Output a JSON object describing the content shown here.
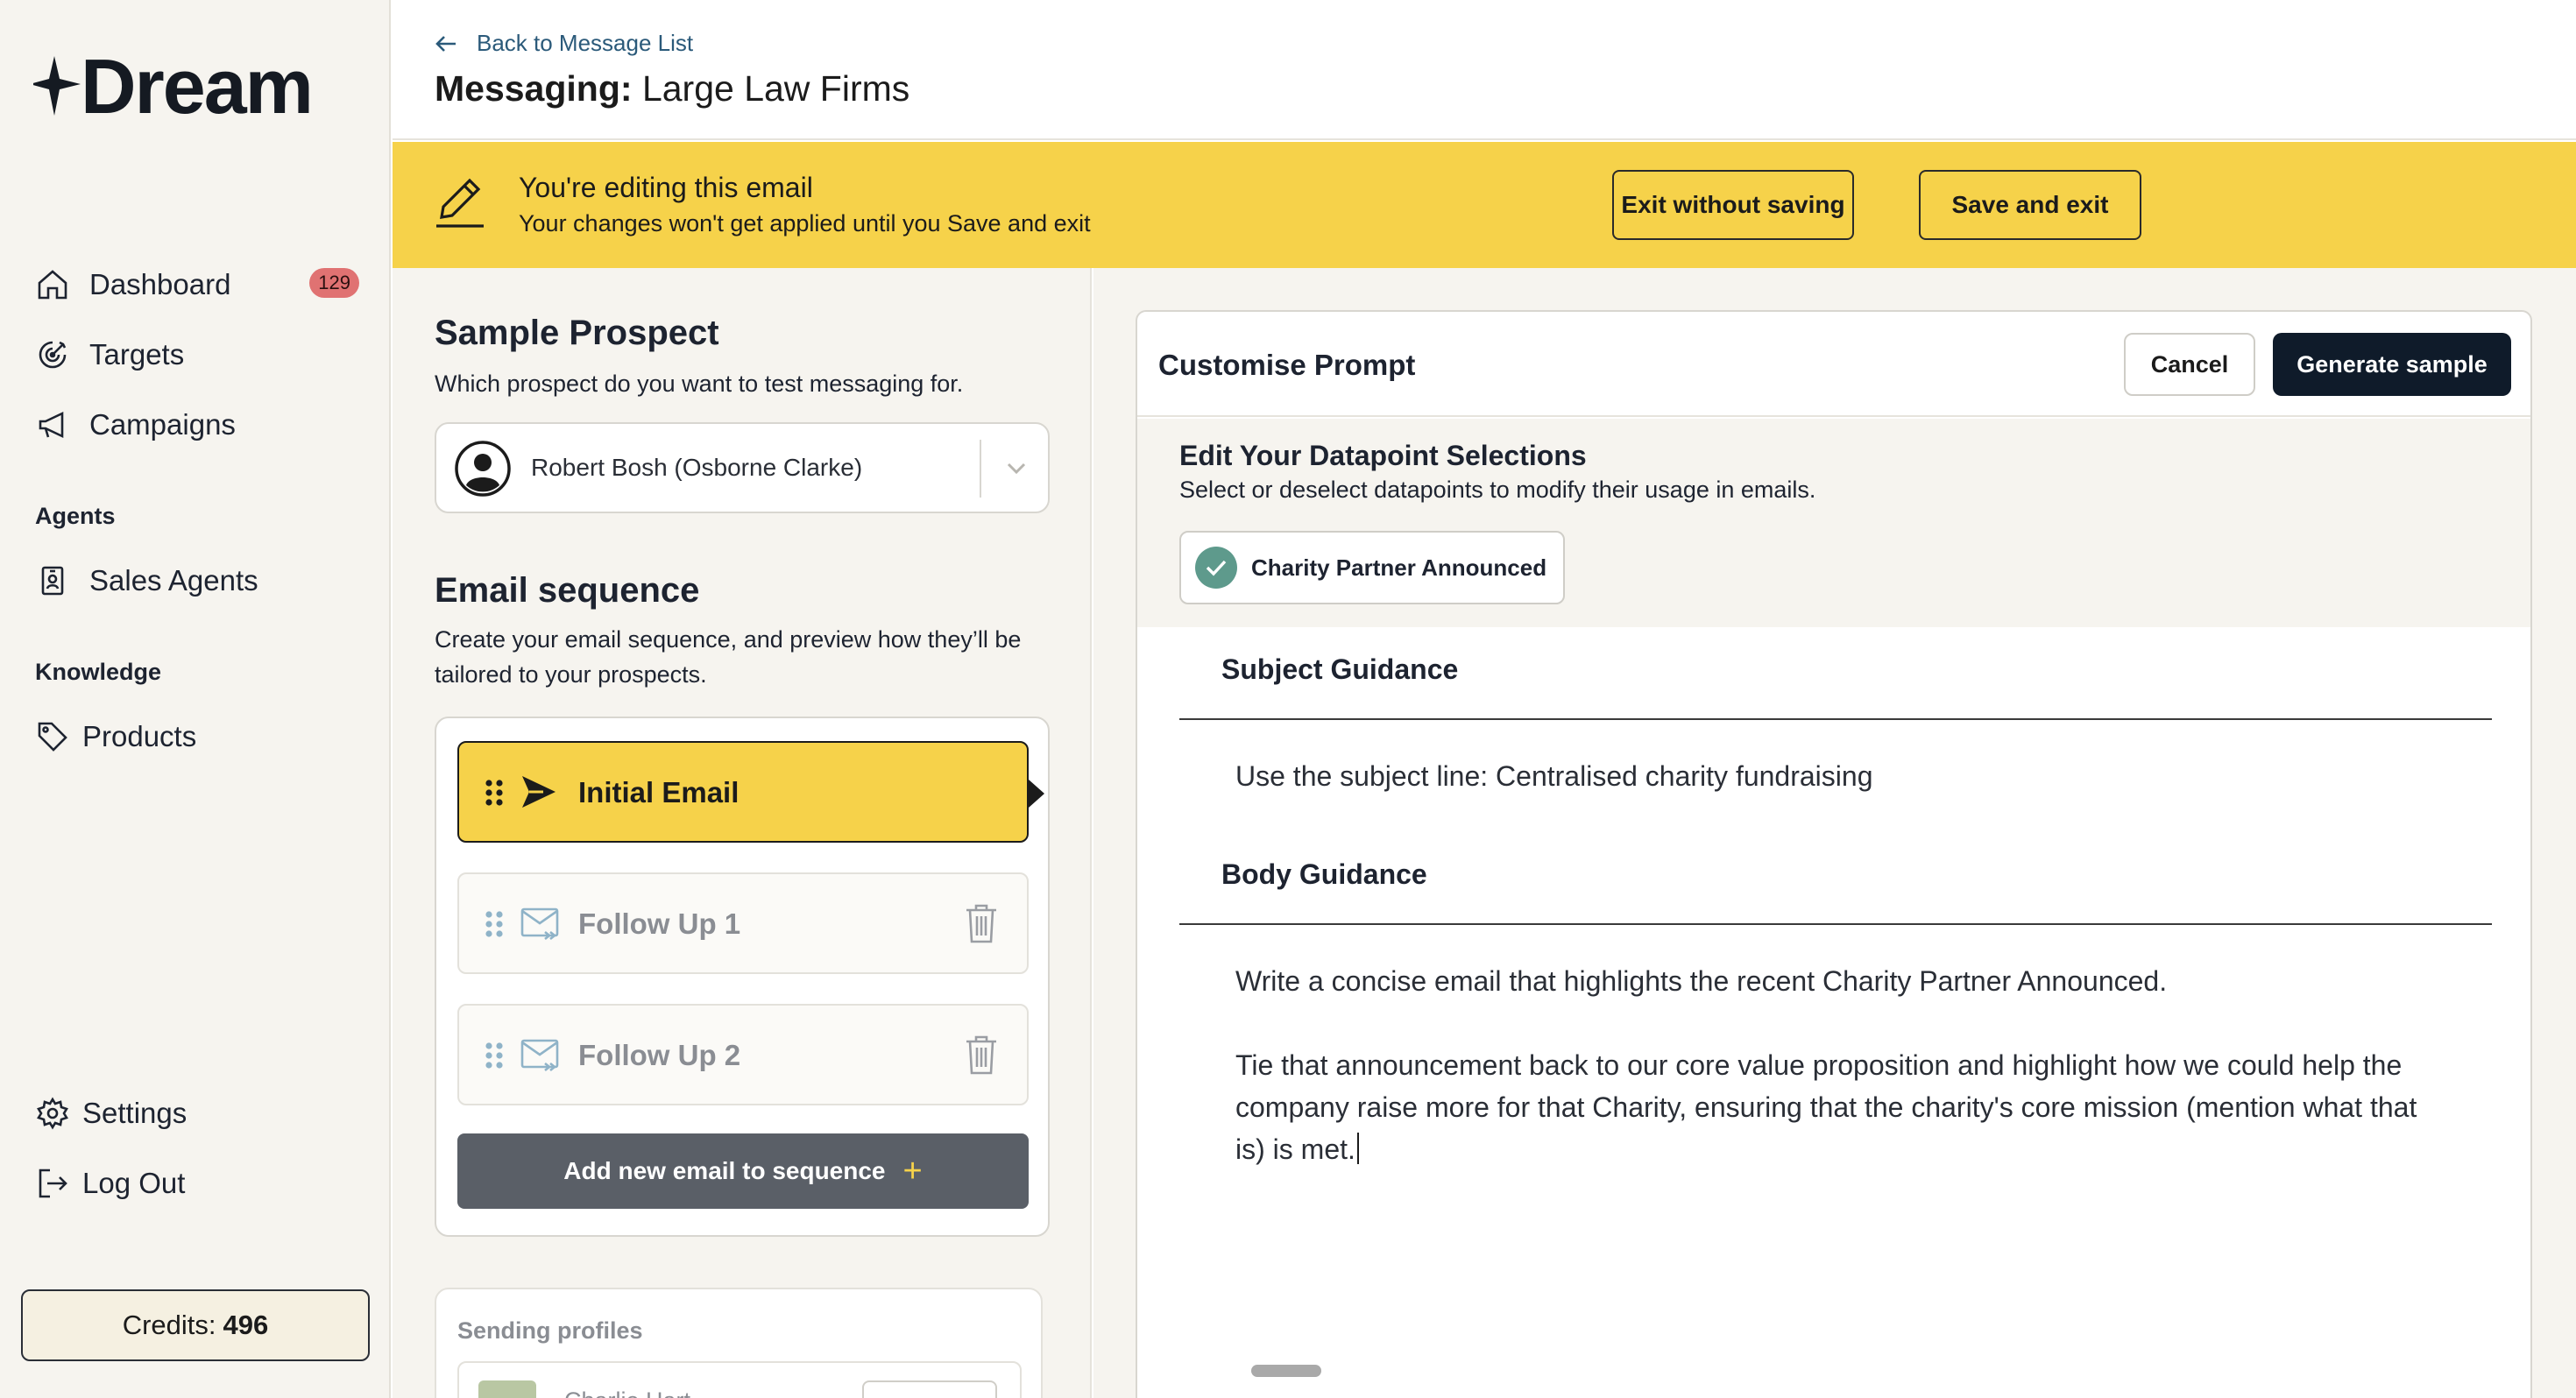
{
  "app": {
    "logo_text": "Dream"
  },
  "sidebar": {
    "nav": [
      {
        "label": "Dashboard",
        "icon": "home-icon",
        "badge": "129"
      },
      {
        "label": "Targets",
        "icon": "target-icon"
      },
      {
        "label": "Campaigns",
        "icon": "megaphone-icon"
      }
    ],
    "sections": {
      "agents": {
        "title": "Agents",
        "items": [
          {
            "label": "Sales Agents",
            "icon": "id-badge-icon"
          }
        ]
      },
      "knowledge": {
        "title": "Knowledge",
        "items": [
          {
            "label": "Products",
            "icon": "tag-icon"
          }
        ]
      }
    },
    "bottom": [
      {
        "label": "Settings",
        "icon": "gear-icon"
      },
      {
        "label": "Log Out",
        "icon": "logout-icon"
      }
    ],
    "credits": {
      "label": "Credits:",
      "value": "496"
    }
  },
  "header": {
    "back_label": "Back to Message List",
    "title_prefix": "Messaging:",
    "title": "Large Law Firms"
  },
  "banner": {
    "title": "You're editing this email",
    "subtitle": "Your changes won't get applied until you Save and exit",
    "exit_label": "Exit without saving",
    "save_label": "Save and exit",
    "color": "#f6d24a"
  },
  "prospect": {
    "title": "Sample Prospect",
    "subtitle": "Which prospect do you want to test messaging for.",
    "selected": "Robert Bosh (Osborne Clarke)"
  },
  "sequence": {
    "title": "Email sequence",
    "subtitle": "Create your email sequence, and preview how they’ll be tailored to your prospects.",
    "items": [
      {
        "label": "Initial Email",
        "active": true
      },
      {
        "label": "Follow Up 1",
        "active": false
      },
      {
        "label": "Follow Up 2",
        "active": false
      }
    ],
    "add_label": "Add new email to sequence",
    "add_symbol": "+"
  },
  "profiles": {
    "title": "Sending profiles",
    "items": [
      {
        "name": "Charlie Hart"
      }
    ]
  },
  "prompt": {
    "title": "Customise Prompt",
    "cancel_label": "Cancel",
    "generate_label": "Generate sample",
    "datapoints": {
      "title": "Edit Your Datapoint Selections",
      "subtitle": "Select or deselect datapoints to modify their usage in emails.",
      "chips": [
        {
          "label": "Charity Partner Announced",
          "selected": true
        }
      ]
    },
    "subject": {
      "label": "Subject Guidance",
      "text": "Use the subject line: Centralised charity fundraising"
    },
    "body": {
      "label": "Body Guidance",
      "paragraph1": "Write a concise email that highlights the recent Charity Partner Announced.",
      "paragraph2": "Tie that announcement back to our core value proposition and highlight how we could help the company raise more for that Charity, ensuring that the charity's core mission (mention what that is) is met."
    }
  }
}
